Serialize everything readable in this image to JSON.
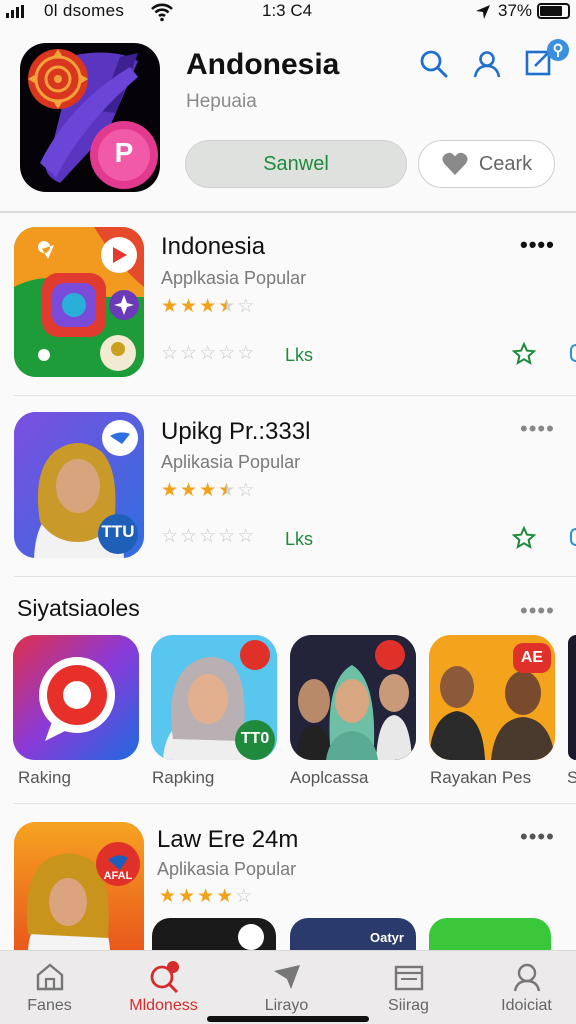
{
  "status_bar": {
    "carrier": "0l dsomes",
    "time": "1:3 C4",
    "battery": "37%"
  },
  "header": {
    "title": "Andonesia",
    "subtitle": "Hepuaia",
    "icon_letter": "P",
    "primary_button": "Sanwel",
    "secondary_button": "Ceark",
    "icons": [
      "search-icon",
      "user-icon",
      "edit-icon"
    ]
  },
  "apps": [
    {
      "title": "Indonesia",
      "subtitle": "Applkasia Popular",
      "rating": 3.5,
      "link": "Lks"
    },
    {
      "title": "Upikg Pr.:333l",
      "subtitle": "Aplikasia Popular",
      "rating": 3.5,
      "link": "Lks",
      "badge": "TTU"
    },
    {
      "title": "Law Ere 24m",
      "subtitle": "Aplikasia Popular",
      "rating": 4,
      "badge": "AFAL"
    }
  ],
  "section": {
    "title": "Siyatsiaoles",
    "cards": [
      {
        "label": "Raking"
      },
      {
        "label": "Rapking",
        "badge": "TT0"
      },
      {
        "label": "Aoplcassa"
      },
      {
        "label": "Rayakan Pes",
        "badge": "AE"
      },
      {
        "label": "S"
      }
    ]
  },
  "partial_badge": "Oatyr",
  "colors": {
    "accent": "#1f8a3c",
    "blue": "#1f6fcc",
    "star": "#f2a21a",
    "active_tab": "#d62b2b"
  },
  "tabs": [
    {
      "label": "Fanes",
      "icon": "home-icon"
    },
    {
      "label": "Mldoness",
      "icon": "search-icon",
      "active": true
    },
    {
      "label": "Lirayo",
      "icon": "paper-plane-icon"
    },
    {
      "label": "Siirag",
      "icon": "inbox-icon"
    },
    {
      "label": "Idoiciat",
      "icon": "profile-icon"
    }
  ]
}
